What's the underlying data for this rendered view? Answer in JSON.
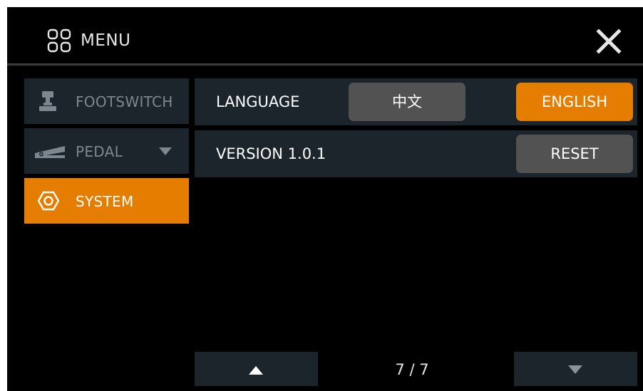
{
  "header": {
    "title": "MENU",
    "menu_icon": "grid-icon",
    "close_icon": "close-icon"
  },
  "sidebar": {
    "items": [
      {
        "label": "FOOTSWITCH",
        "icon": "footswitch-icon",
        "active": false
      },
      {
        "label": "PEDAL",
        "icon": "pedal-icon",
        "active": false,
        "has_dropdown": true
      },
      {
        "label": "SYSTEM",
        "icon": "hexagon-settings-icon",
        "active": true
      }
    ]
  },
  "settings": {
    "language": {
      "label": "LANGUAGE",
      "options": [
        "中文",
        "ENGLISH"
      ],
      "selected": "ENGLISH"
    },
    "version": {
      "label": "VERSION 1.0.1",
      "reset_label": "RESET"
    }
  },
  "pagination": {
    "indicator": "7 / 7",
    "up_icon": "triangle-up-icon",
    "down_icon": "triangle-down-icon"
  },
  "colors": {
    "accent": "#e57d00",
    "panel": "#1d252c",
    "button_gray": "#525252",
    "background": "#000000"
  }
}
